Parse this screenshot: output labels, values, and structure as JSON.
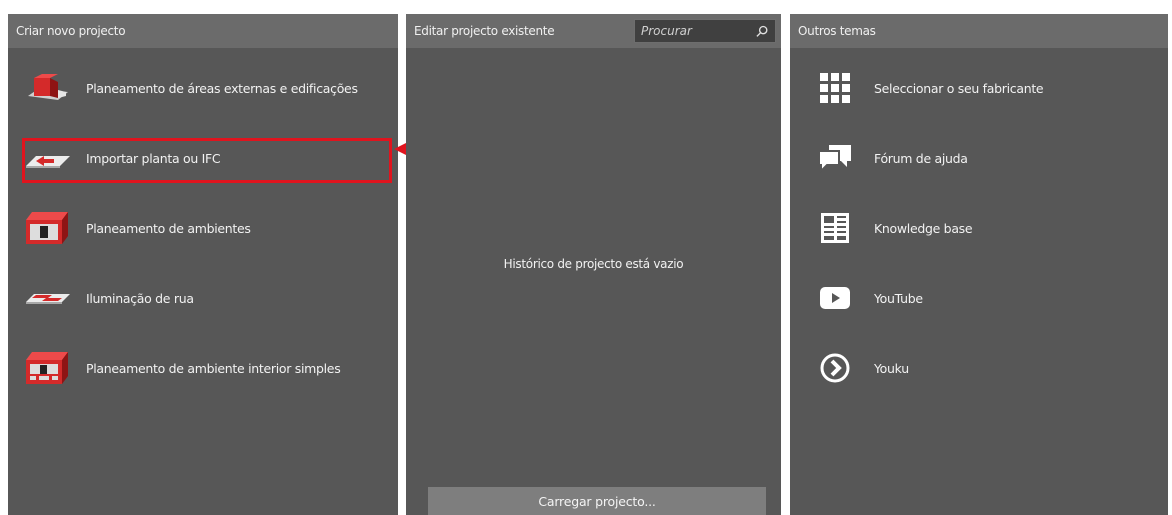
{
  "colors": {
    "panel": "#575757",
    "header": "#6b6b6b",
    "accent": "#e0141e",
    "icon_red": "#d42a2a"
  },
  "create": {
    "header": "Criar novo projecto",
    "items": [
      {
        "label": "Planeamento de áreas externas e edificações",
        "icon": "outdoor-building-icon"
      },
      {
        "label": "Importar planta ou IFC",
        "icon": "import-plan-icon"
      },
      {
        "label": "Planeamento de ambientes",
        "icon": "room-planning-icon"
      },
      {
        "label": "Iluminação de rua",
        "icon": "street-lighting-icon"
      },
      {
        "label": "Planeamento de ambiente interior simples",
        "icon": "simple-interior-icon"
      }
    ]
  },
  "edit": {
    "header": "Editar projecto existente",
    "search_placeholder": "Procurar",
    "empty_message": "Histórico de projecto está vazio",
    "load_button": "Carregar projecto..."
  },
  "other": {
    "header": "Outros temas",
    "items": [
      {
        "label": "Seleccionar o seu fabricante",
        "icon": "grid-icon"
      },
      {
        "label": "Fórum de ajuda",
        "icon": "forum-icon"
      },
      {
        "label": "Knowledge base",
        "icon": "knowledge-base-icon"
      },
      {
        "label": "YouTube",
        "icon": "youtube-icon"
      },
      {
        "label": "Youku",
        "icon": "youku-icon"
      }
    ]
  }
}
